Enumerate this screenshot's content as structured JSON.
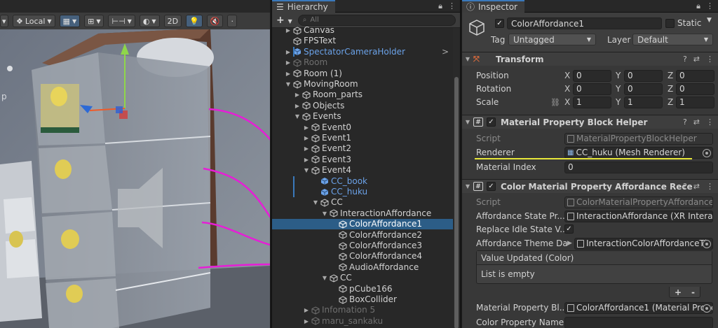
{
  "scene": {
    "toolbar": {
      "pivot_label": "Local",
      "mode_2d_label": "2D"
    },
    "side_glyph": "p",
    "colors": {
      "annotation": "#e61ed6"
    }
  },
  "hierarchy": {
    "tab_title": "Hierarchy",
    "search_placeholder": "All",
    "add_label": "+",
    "rows": [
      {
        "label": "Canvas",
        "indent": 1,
        "fold": "closed",
        "style": "normal"
      },
      {
        "label": "FPSText",
        "indent": 1,
        "fold": "none",
        "style": "normal"
      },
      {
        "label": "SpectatorCameraHolder",
        "indent": 1,
        "fold": "closed",
        "style": "prefab",
        "arrow": ">"
      },
      {
        "label": "Room",
        "indent": 1,
        "fold": "closed",
        "style": "dim"
      },
      {
        "label": "Room (1)",
        "indent": 1,
        "fold": "closed",
        "style": "normal"
      },
      {
        "label": "MovingRoom",
        "indent": 1,
        "fold": "open",
        "style": "normal"
      },
      {
        "label": "Room_parts",
        "indent": 2,
        "fold": "closed",
        "style": "normal"
      },
      {
        "label": "Objects",
        "indent": 2,
        "fold": "closed",
        "style": "normal"
      },
      {
        "label": "Events",
        "indent": 2,
        "fold": "open",
        "style": "normal"
      },
      {
        "label": "Event0",
        "indent": 3,
        "fold": "closed",
        "style": "normal"
      },
      {
        "label": "Event1",
        "indent": 3,
        "fold": "closed",
        "style": "normal"
      },
      {
        "label": "Event2",
        "indent": 3,
        "fold": "closed",
        "style": "normal"
      },
      {
        "label": "Event3",
        "indent": 3,
        "fold": "closed",
        "style": "normal"
      },
      {
        "label": "Event4",
        "indent": 3,
        "fold": "open",
        "style": "normal"
      },
      {
        "label": "CC_book",
        "indent": 4,
        "fold": "none",
        "style": "prefab"
      },
      {
        "label": "CC_huku",
        "indent": 4,
        "fold": "none",
        "style": "prefab"
      },
      {
        "label": "CC",
        "indent": 4,
        "fold": "open",
        "style": "normal"
      },
      {
        "label": "InteractionAffordance",
        "indent": 5,
        "fold": "open",
        "style": "normal"
      },
      {
        "label": "ColorAffordance1",
        "indent": 6,
        "fold": "none",
        "style": "normal",
        "selected": true
      },
      {
        "label": "ColorAffordance2",
        "indent": 6,
        "fold": "none",
        "style": "normal"
      },
      {
        "label": "ColorAffordance3",
        "indent": 6,
        "fold": "none",
        "style": "normal"
      },
      {
        "label": "ColorAffordance4",
        "indent": 6,
        "fold": "none",
        "style": "normal"
      },
      {
        "label": "AudioAffordance",
        "indent": 6,
        "fold": "none",
        "style": "normal"
      },
      {
        "label": "CC",
        "indent": 5,
        "fold": "open",
        "style": "normal"
      },
      {
        "label": "pCube166",
        "indent": 6,
        "fold": "none",
        "style": "normal"
      },
      {
        "label": "BoxCollider",
        "indent": 6,
        "fold": "none",
        "style": "normal"
      },
      {
        "label": "Infomation 5",
        "indent": 3,
        "fold": "closed",
        "style": "dim"
      },
      {
        "label": "maru_sankaku",
        "indent": 3,
        "fold": "closed",
        "style": "dim"
      }
    ]
  },
  "inspector": {
    "tab_title": "Inspector",
    "object_name": "ColorAffordance1",
    "static_label": "Static",
    "tag_label": "Tag",
    "tag_value": "Untagged",
    "layer_label": "Layer",
    "layer_value": "Default",
    "transform": {
      "title": "Transform",
      "position_label": "Position",
      "rotation_label": "Rotation",
      "scale_label": "Scale",
      "position": [
        "0",
        "0",
        "0"
      ],
      "rotation": [
        "0",
        "0",
        "0"
      ],
      "scale": [
        "1",
        "1",
        "1"
      ],
      "axis_x": "X",
      "axis_y": "Y",
      "axis_z": "Z"
    },
    "mpb_helper": {
      "title": "Material Property Block Helper",
      "script_label": "Script",
      "script_value": "MaterialPropertyBlockHelper",
      "renderer_label": "Renderer",
      "renderer_value": "CC_huku (Mesh Renderer)",
      "material_index_label": "Material Index",
      "material_index_value": "0"
    },
    "color_affordance": {
      "title": "Color Material Property Affordance Rece",
      "script_label": "Script",
      "script_value": "ColorMaterialPropertyAffordance",
      "state_provider_label": "Affordance State Pr...",
      "state_provider_value": "InteractionAffordance (XR Interac",
      "replace_idle_label": "Replace Idle State V...",
      "theme_label": "Affordance Theme Da",
      "theme_value": "InteractionColorAffordanceTh",
      "event_title": "Value Updated (Color)",
      "event_empty": "List is empty",
      "plus": "+",
      "minus": "-",
      "mpb_label": "Material Property Bl...",
      "mpb_value": "ColorAffordance1 (Material Prope",
      "color_prop_label": "Color Property Name"
    }
  }
}
